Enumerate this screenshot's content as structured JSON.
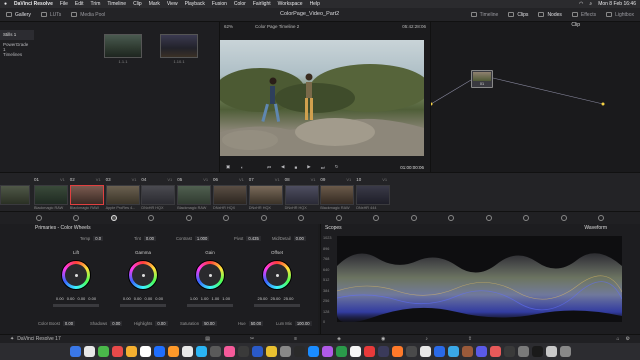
{
  "menubar": {
    "apple": "",
    "app": "DaVinci Resolve",
    "items": [
      "File",
      "Edit",
      "Trim",
      "Timeline",
      "Clip",
      "Mark",
      "View",
      "Playback",
      "Fusion",
      "Color",
      "Fairlight",
      "Workspace",
      "Help"
    ],
    "datetime": "Mon 8 Feb  16:46"
  },
  "toolbar": {
    "gallery": "Gallery",
    "luts": "LUTs",
    "media_pool": "Media Pool",
    "project": "ColorPage_Video_Part2",
    "timeline": "Timeline",
    "clips": "Clips",
    "nodes": "Nodes",
    "effects": "Effects",
    "lightbox": "Lightbox"
  },
  "gallery": {
    "albums": [
      "Stills 1",
      "PowerGrade 1",
      "Timelines"
    ],
    "stills": [
      "1.1.1",
      "1.10.1"
    ]
  },
  "viewer": {
    "zoom": "62%",
    "timeline_name": "Color Page Timeline 2",
    "timecode_top": "05:42:28:06",
    "timecode": "01:00:00:06"
  },
  "nodes": {
    "mode": "Clip",
    "node_label": "01"
  },
  "clips": [
    {
      "num": "01",
      "track": "V1",
      "label": "Blackmagic RAW"
    },
    {
      "num": "02",
      "track": "V1",
      "label": "Blackmagic RAW"
    },
    {
      "num": "03",
      "track": "V1",
      "label": "Apple ProRes 4..."
    },
    {
      "num": "04",
      "track": "V1",
      "label": "DNxHR HQX"
    },
    {
      "num": "05",
      "track": "V1",
      "label": "Blackmagic RAW"
    },
    {
      "num": "06",
      "track": "V1",
      "label": "DNxHR HQX"
    },
    {
      "num": "07",
      "track": "V1",
      "label": "DNxHR HQX"
    },
    {
      "num": "08",
      "track": "V1",
      "label": "DNxHR HQX"
    },
    {
      "num": "09",
      "track": "V1",
      "label": "Blackmagic RAW"
    },
    {
      "num": "10",
      "track": "V1",
      "label": "DNxHR 444"
    }
  ],
  "primaries": {
    "title": "Primaries - Color Wheels",
    "temp_label": "Temp",
    "temp": "0.0",
    "tint_label": "Tint",
    "tint": "0.00",
    "contrast_label": "Contrast",
    "contrast": "1.000",
    "pivot_label": "Pivot",
    "pivot": "0.435",
    "middetail_label": "Mid/Detail",
    "middetail": "0.00",
    "wheels": [
      {
        "name": "Lift",
        "vals": [
          "0.00",
          "0.00",
          "0.00",
          "0.00"
        ]
      },
      {
        "name": "Gamma",
        "vals": [
          "0.00",
          "0.00",
          "0.00",
          "0.00"
        ]
      },
      {
        "name": "Gain",
        "vals": [
          "1.00",
          "1.00",
          "1.00",
          "1.00"
        ]
      },
      {
        "name": "Offset",
        "vals": [
          "25.00",
          "25.00",
          "25.00",
          ""
        ]
      }
    ],
    "colorboost_label": "Color Boost",
    "colorboost": "0.00",
    "shadows_label": "Shadows",
    "shadows": "0.00",
    "highlights_label": "Highlights",
    "highlights": "0.00",
    "saturation_label": "Saturation",
    "saturation": "50.00",
    "hue_label": "Hue",
    "hue": "50.00",
    "lummix_label": "Lum Mix",
    "lummix": "100.00"
  },
  "scopes": {
    "title": "Scopes",
    "mode": "Waveform",
    "ticks": [
      "1023",
      "896",
      "768",
      "640",
      "512",
      "384",
      "256",
      "128",
      "0"
    ]
  },
  "bottom": {
    "product": "DaVinci Resolve 17"
  }
}
